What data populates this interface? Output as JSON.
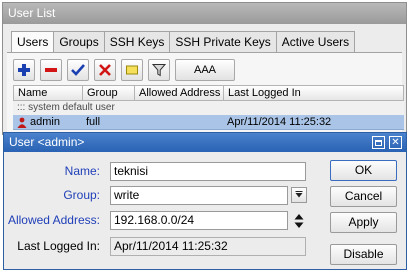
{
  "user_list": {
    "title": "User List",
    "tabs": [
      "Users",
      "Groups",
      "SSH Keys",
      "SSH Private Keys",
      "Active Users"
    ],
    "toolbar": {
      "find_label": "AAA"
    },
    "columns": [
      "Name",
      "Group",
      "Allowed Address",
      "Last Logged In"
    ],
    "comment": "::: system default user",
    "rows": [
      {
        "name": "admin",
        "group": "full",
        "allowed_address": "",
        "last_logged_in": "Apr/11/2014 11:25:32"
      }
    ]
  },
  "dialog": {
    "title": "User <admin>",
    "fields": {
      "name_label": "Name:",
      "name_value": "teknisi",
      "group_label": "Group:",
      "group_value": "write",
      "allowed_address_label": "Allowed Address:",
      "allowed_address_value": "192.168.0.0/24",
      "last_logged_in_label": "Last Logged In:",
      "last_logged_in_value": "Apr/11/2014 11:25:32"
    },
    "buttons": {
      "ok": "OK",
      "cancel": "Cancel",
      "apply": "Apply",
      "disable": "Disable"
    }
  },
  "colors": {
    "selected_row": "#a9c4e6",
    "dialog_title": "#2a62b4",
    "label_blue": "#1f3fb8"
  }
}
